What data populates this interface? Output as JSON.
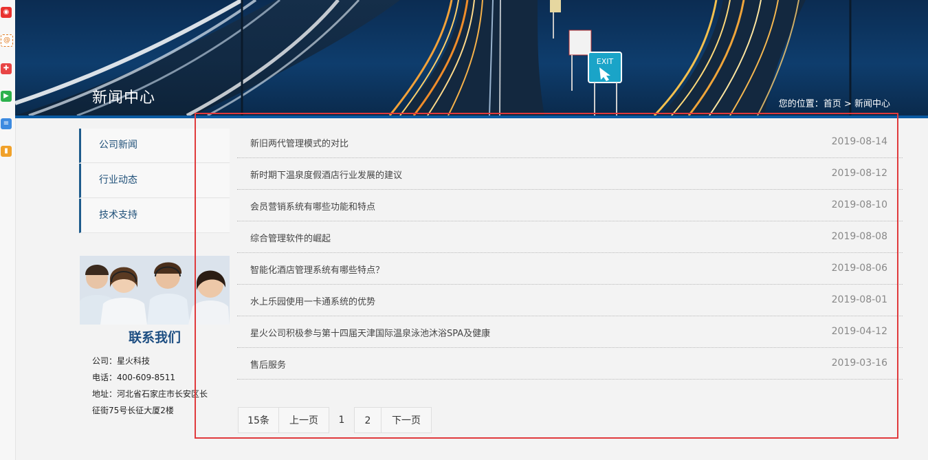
{
  "banner": {
    "title": "新闻中心"
  },
  "breadcrumb": {
    "prefix": "您的位置：",
    "home": "首页",
    "sep": ">",
    "current": "新闻中心"
  },
  "sidebar": {
    "items": [
      {
        "label": "公司新闻"
      },
      {
        "label": "行业动态"
      },
      {
        "label": "技术支持"
      }
    ]
  },
  "contact": {
    "title": "联系我们",
    "company": "公司：星火科技",
    "phone": "电话：400-609-8511",
    "address_line1": "地址：河北省石家庄市长安区长",
    "address_line2": "征街75号长征大厦2楼"
  },
  "news": [
    {
      "title": "新旧两代管理模式的对比",
      "date": "2019-08-14"
    },
    {
      "title": "新时期下温泉度假酒店行业发展的建议",
      "date": "2019-08-12"
    },
    {
      "title": "会员营销系统有哪些功能和特点",
      "date": "2019-08-10"
    },
    {
      "title": "综合管理软件的崛起",
      "date": "2019-08-08"
    },
    {
      "title": "智能化酒店管理系统有哪些特点？",
      "date": "2019-08-06"
    },
    {
      "title": "水上乐园使用一卡通系统的优势",
      "date": "2019-08-01"
    },
    {
      "title": "星火公司积极参与第十四届天津国际温泉泳池沐浴SPA及健康",
      "date": "2019-04-12"
    },
    {
      "title": "售后服务",
      "date": "2019-03-16"
    }
  ],
  "pager": {
    "total": "15条",
    "prev": "上一页",
    "page1": "1",
    "page2": "2",
    "next": "下一页"
  },
  "banner_sign": "EXIT",
  "colors": {
    "accent": "#1e5b8c",
    "highlight": "#e0393b",
    "banner_strip": "#0a5aa3"
  }
}
